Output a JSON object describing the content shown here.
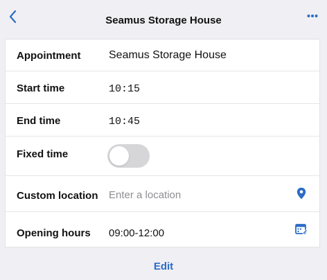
{
  "header": {
    "title": "Seamus Storage House",
    "back_icon": "chevron-left-icon",
    "more_icon": "ellipsis-icon"
  },
  "form": {
    "appointment": {
      "label": "Appointment",
      "value": "Seamus Storage House"
    },
    "start_time": {
      "label": "Start time",
      "value": "10:15"
    },
    "end_time": {
      "label": "End time",
      "value": "10:45"
    },
    "fixed_time": {
      "label": "Fixed time",
      "enabled": false
    },
    "custom_location": {
      "label": "Custom location",
      "value": "",
      "placeholder": "Enter a location",
      "icon": "location-pin-icon"
    },
    "opening_hours": {
      "label": "Opening hours",
      "value": "09:00-12:00",
      "icon": "calendar-edit-icon"
    }
  },
  "footer": {
    "edit_label": "Edit"
  },
  "colors": {
    "accent": "#2b6cc4",
    "background": "#efeff4",
    "toggle_off": "#d6d6d9"
  }
}
